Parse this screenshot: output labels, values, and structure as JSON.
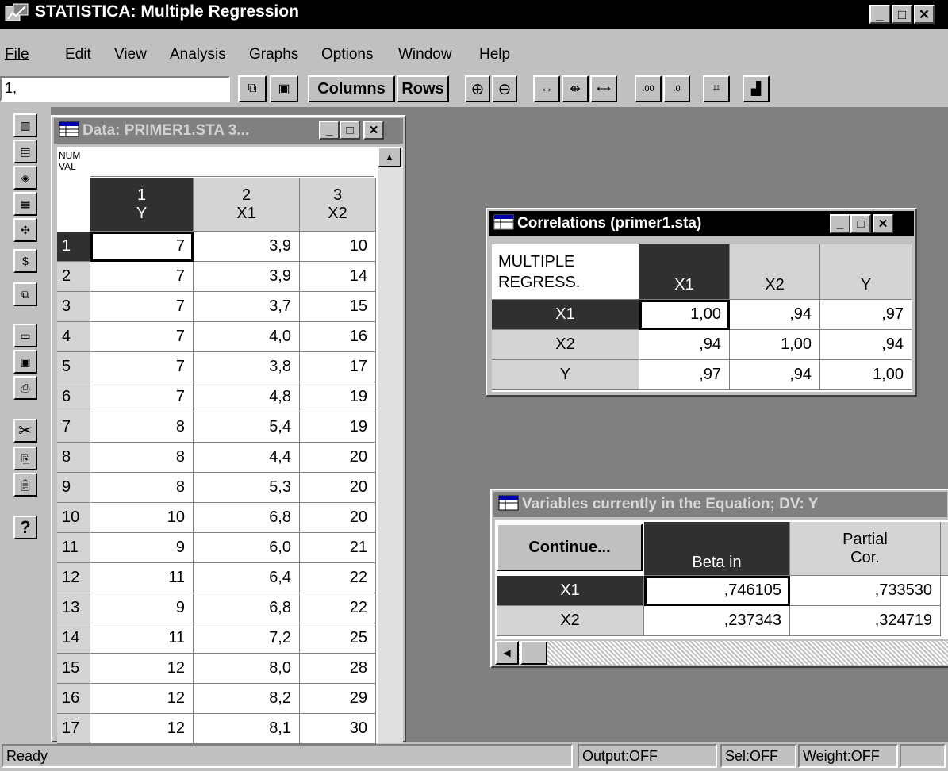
{
  "app": {
    "title": "STATISTICA: Multiple Regression"
  },
  "menu": [
    "File",
    "Edit",
    "View",
    "Analysis",
    "Graphs",
    "Options",
    "Window",
    "Help"
  ],
  "toolbar": {
    "cell_ref": "1,",
    "columns_label": "Columns",
    "rows_label": "Rows"
  },
  "data_window": {
    "title": "Data: PRIMER1.STA 3...",
    "corner_top": "NUM",
    "corner_bottom": "VAL",
    "columns": [
      {
        "num": "1",
        "name": "Y"
      },
      {
        "num": "2",
        "name": "X1"
      },
      {
        "num": "3",
        "name": "X2"
      }
    ],
    "rows": [
      [
        "1",
        "7",
        "3,9",
        "10"
      ],
      [
        "2",
        "7",
        "3,9",
        "14"
      ],
      [
        "3",
        "7",
        "3,7",
        "15"
      ],
      [
        "4",
        "7",
        "4,0",
        "16"
      ],
      [
        "5",
        "7",
        "3,8",
        "17"
      ],
      [
        "6",
        "7",
        "4,8",
        "19"
      ],
      [
        "7",
        "8",
        "5,4",
        "19"
      ],
      [
        "8",
        "8",
        "4,4",
        "20"
      ],
      [
        "9",
        "8",
        "5,3",
        "20"
      ],
      [
        "10",
        "10",
        "6,8",
        "20"
      ],
      [
        "11",
        "9",
        "6,0",
        "21"
      ],
      [
        "12",
        "11",
        "6,4",
        "22"
      ],
      [
        "13",
        "9",
        "6,8",
        "22"
      ],
      [
        "14",
        "11",
        "7,2",
        "25"
      ],
      [
        "15",
        "12",
        "8,0",
        "28"
      ],
      [
        "16",
        "12",
        "8,2",
        "29"
      ],
      [
        "17",
        "12",
        "8,1",
        "30"
      ]
    ]
  },
  "corr_window": {
    "title": "Correlations (primer1.sta)",
    "corner_line1": "MULTIPLE",
    "corner_line2": "REGRESS.",
    "columns": [
      "X1",
      "X2",
      "Y"
    ],
    "rows": [
      [
        "X1",
        "1,00",
        ",94",
        ",97"
      ],
      [
        "X2",
        ",94",
        "1,00",
        ",94"
      ],
      [
        "Y",
        ",97",
        ",94",
        "1,00"
      ]
    ]
  },
  "vars_window": {
    "title": "Variables currently in the Equation; DV: Y",
    "continue_label": "Continue...",
    "col1": "Beta in",
    "col2_line1": "Partial",
    "col2_line2": "Cor.",
    "rows": [
      [
        "X1",
        ",746105",
        ",733530"
      ],
      [
        "X2",
        ",237343",
        ",324719"
      ]
    ]
  },
  "status": {
    "ready": "Ready",
    "output": "Output:OFF",
    "sel": "Sel:OFF",
    "weight": "Weight:OFF"
  }
}
